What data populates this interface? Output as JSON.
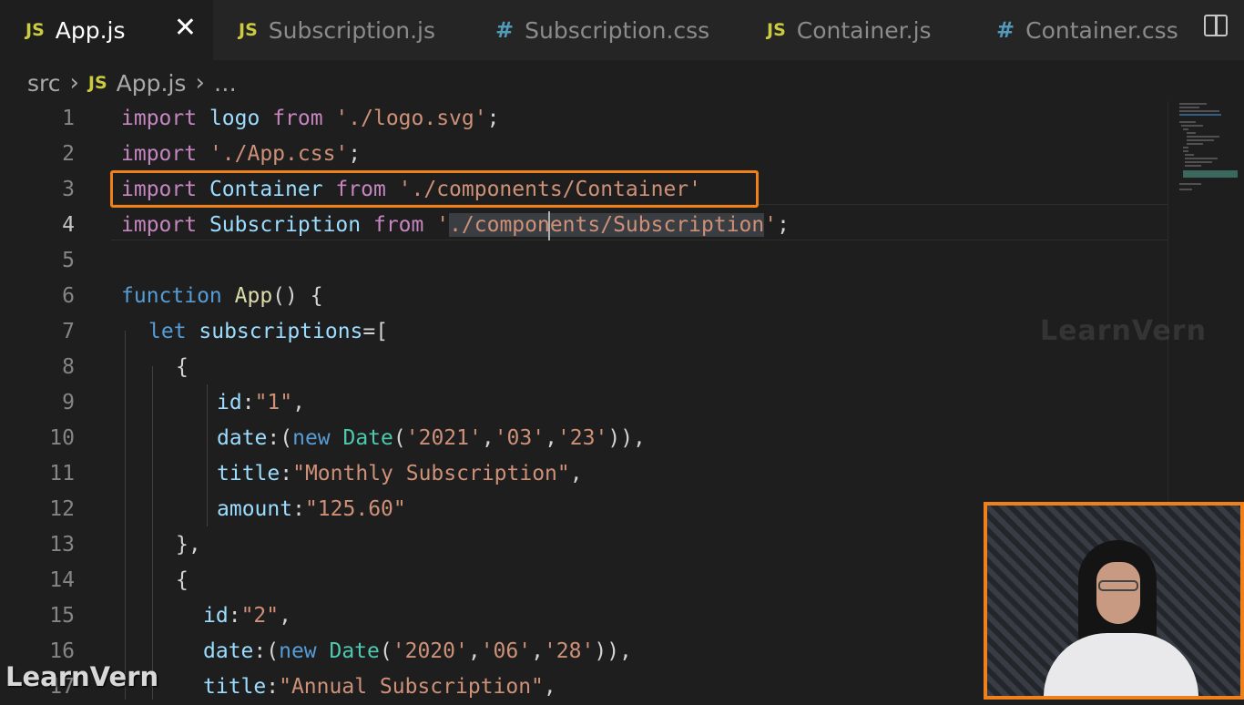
{
  "tabs": [
    {
      "name": "App.js",
      "type": "js",
      "active": true
    },
    {
      "name": "Subscription.js",
      "type": "js",
      "active": false
    },
    {
      "name": "Subscription.css",
      "type": "css",
      "active": false
    },
    {
      "name": "Container.js",
      "type": "js",
      "active": false
    },
    {
      "name": "Container.css",
      "type": "css",
      "active": false
    }
  ],
  "tab_icons": {
    "js": "JS",
    "css": "#",
    "close": "✕",
    "split": "split-editor-icon"
  },
  "breadcrumb": {
    "folder": "src",
    "file": "App.js",
    "more": "…",
    "sep": "›",
    "file_icon": "JS"
  },
  "line_numbers": [
    "1",
    "2",
    "3",
    "4",
    "5",
    "6",
    "7",
    "8",
    "9",
    "10",
    "11",
    "12",
    "13",
    "14",
    "15",
    "16",
    "17"
  ],
  "code_tokens": {
    "l1": [
      "import",
      " logo ",
      "from",
      " './logo.svg'",
      ";"
    ],
    "l2": [
      "import",
      " './App.css'",
      ";"
    ],
    "l3": [
      "import",
      " Container ",
      "from",
      " './components/Container'"
    ],
    "l4": [
      "import",
      " Subscription ",
      "from",
      " '",
      "./components/Subscription",
      "'",
      ";"
    ],
    "l6": [
      "function",
      " App",
      "() {"
    ],
    "l7": [
      "let",
      " subscriptions",
      "=["
    ],
    "l8": [
      "{"
    ],
    "l9": [
      "id",
      ":",
      "\"1\"",
      ","
    ],
    "l10": [
      "date",
      ":(",
      "new",
      " Date",
      "(",
      "'2021'",
      ",",
      "'03'",
      ",",
      "'23'",
      ")),"
    ],
    "l11": [
      "title",
      ":",
      "\"Monthly Subscription\"",
      ","
    ],
    "l12": [
      "amount",
      ":",
      "\"125.60\""
    ],
    "l13": [
      "},"
    ],
    "l14": [
      "{"
    ],
    "l15": [
      "id",
      ":",
      "\"2\"",
      ","
    ],
    "l16": [
      "date",
      ":(",
      "new",
      " Date",
      "(",
      "'2020'",
      ",",
      "'06'",
      ",",
      "'28'",
      ")),"
    ],
    "l17": [
      "title",
      ":",
      "\"Annual Subscription\"",
      ","
    ]
  },
  "watermark": {
    "top": "LearnVern",
    "bottom": "LearnVern"
  },
  "colors": {
    "highlight": "#f0801a",
    "keyword": "#c586c0",
    "string": "#ce9178",
    "variable": "#9cdcfe"
  }
}
